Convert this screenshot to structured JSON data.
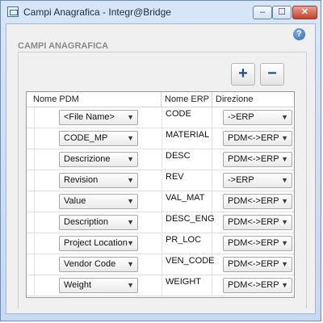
{
  "window": {
    "title": "Campi Anagrafica - Integr@Bridge",
    "controls": {
      "minimize": "–",
      "maximize": "☐",
      "close": "✕"
    }
  },
  "section": {
    "title": "CAMPI ANAGRAFICA"
  },
  "toolbar": {
    "add": "+",
    "remove": "−",
    "help": "?"
  },
  "table": {
    "headers": {
      "pdm": "Nome PDM",
      "erp": "Nome ERP",
      "dir": "Direzione"
    },
    "rows": [
      {
        "pdm": "<File Name>",
        "erp": "CODE",
        "dir": "->ERP"
      },
      {
        "pdm": "CODE_MP",
        "erp": "MATERIAL",
        "dir": "PDM<->ERP"
      },
      {
        "pdm": "Descrizione",
        "erp": "DESC",
        "dir": "PDM<->ERP"
      },
      {
        "pdm": "Revision",
        "erp": "REV",
        "dir": "->ERP"
      },
      {
        "pdm": "Value",
        "erp": "VAL_MAT",
        "dir": "PDM<->ERP"
      },
      {
        "pdm": "Description",
        "erp": "DESC_ENG",
        "dir": "PDM<->ERP"
      },
      {
        "pdm": "Project Location",
        "erp": "PR_LOC",
        "dir": "PDM<->ERP"
      },
      {
        "pdm": "Vendor Code",
        "erp": "VEN_CODE",
        "dir": "PDM<->ERP"
      },
      {
        "pdm": "Weight",
        "erp": "WEIGHT",
        "dir": "PDM<->ERP"
      }
    ]
  },
  "icons": {
    "window": "app-icon",
    "help": "help-icon",
    "dropdown": "chevron-down-icon"
  }
}
